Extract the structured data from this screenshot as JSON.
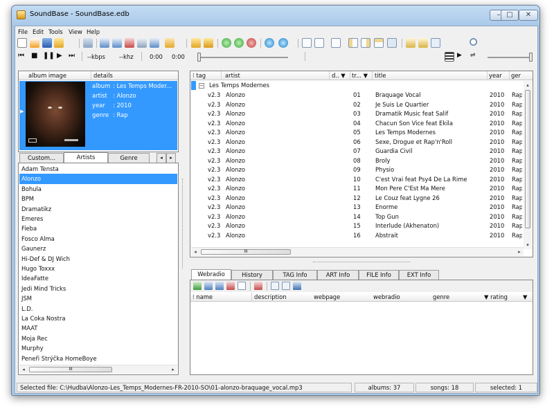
{
  "window": {
    "title": "SoundBase - SoundBase.edb"
  },
  "controls": {
    "minimize": "–",
    "maximize": "□",
    "close": "✕"
  },
  "menu": [
    "File",
    "Edit",
    "Tools",
    "View",
    "Help"
  ],
  "player": {
    "kbps": "--kbps",
    "khz": "--khz",
    "time_elapsed": "0:00",
    "time_total": "0:00"
  },
  "album_panel": {
    "headers": {
      "image": "album image",
      "details": "details"
    },
    "details": [
      {
        "label": "album",
        "value": ": Les Temps Moder..."
      },
      {
        "label": "artist",
        "value": ": Alonzo"
      },
      {
        "label": "year",
        "value": ": 2010"
      },
      {
        "label": "genre",
        "value": ": Rap"
      }
    ]
  },
  "left_tabs": [
    "Custom...",
    "Artists",
    "Genre"
  ],
  "left_tabs_active": 1,
  "artists": [
    "Adam Tensta",
    "Alonzo",
    "Bohula",
    "BPM",
    "Dramatikz",
    "Emeres",
    "Fieba",
    "Fosco Alma",
    "Gaunerz",
    "Hi-Def & DJ Wich",
    "Hugo Toxxx",
    "IdeaFatte",
    "Jedi Mind Tricks",
    "JSM",
    "L.D.",
    "La Coka Nostra",
    "MAAT",
    "Moja Rec",
    "Murphy",
    "Peneři Strýčka HomeBoye"
  ],
  "artists_selected": 1,
  "tracks": {
    "headers": {
      "tag": "tag",
      "artist": "artist",
      "d": "d.. ▼",
      "tr": "tr... ▼",
      "title": "title",
      "year": "year",
      "genre": "genr"
    },
    "group": "Les Temps Modernes",
    "rows": [
      {
        "tag": "v2.3",
        "artist": "Alonzo",
        "track": "01",
        "title": "Braquage Vocal",
        "year": "2010",
        "genre": "Rap"
      },
      {
        "tag": "v2.3",
        "artist": "Alonzo",
        "track": "02",
        "title": "Je Suis Le Quartier",
        "year": "2010",
        "genre": "Rap"
      },
      {
        "tag": "v2.3",
        "artist": "Alonzo",
        "track": "03",
        "title": "Dramatik Music feat Salif",
        "year": "2010",
        "genre": "Rap"
      },
      {
        "tag": "v2.3",
        "artist": "Alonzo",
        "track": "04",
        "title": "Chacun Son Vice feat Ekila",
        "year": "2010",
        "genre": "Rap"
      },
      {
        "tag": "v2.3",
        "artist": "Alonzo",
        "track": "05",
        "title": "Les Temps Modernes",
        "year": "2010",
        "genre": "Rap"
      },
      {
        "tag": "v2.3",
        "artist": "Alonzo",
        "track": "06",
        "title": "Sexe, Drogue et Rap'n'Roll",
        "year": "2010",
        "genre": "Rap"
      },
      {
        "tag": "v2.3",
        "artist": "Alonzo",
        "track": "07",
        "title": "Guardia Civil",
        "year": "2010",
        "genre": "Rap"
      },
      {
        "tag": "v2.3",
        "artist": "Alonzo",
        "track": "08",
        "title": "Broly",
        "year": "2010",
        "genre": "Rap"
      },
      {
        "tag": "v2.3",
        "artist": "Alonzo",
        "track": "09",
        "title": "Physio",
        "year": "2010",
        "genre": "Rap"
      },
      {
        "tag": "v2.3",
        "artist": "Alonzo",
        "track": "10",
        "title": "C'est Vrai feat Psy4 De La Rime",
        "year": "2010",
        "genre": "Rap"
      },
      {
        "tag": "v2.3",
        "artist": "Alonzo",
        "track": "11",
        "title": "Mon Pere C'Est Ma Mere",
        "year": "2010",
        "genre": "Rap"
      },
      {
        "tag": "v2.3",
        "artist": "Alonzo",
        "track": "12",
        "title": "Le Couz feat Lygne 26",
        "year": "2010",
        "genre": "Rap"
      },
      {
        "tag": "v2.3",
        "artist": "Alonzo",
        "track": "13",
        "title": "Enorme",
        "year": "2010",
        "genre": "Rap"
      },
      {
        "tag": "v2.3",
        "artist": "Alonzo",
        "track": "14",
        "title": "Top Gun",
        "year": "2010",
        "genre": "Rap"
      },
      {
        "tag": "v2.3",
        "artist": "Alonzo",
        "track": "15",
        "title": "Interlude (Akhenaton)",
        "year": "2010",
        "genre": "Rap"
      },
      {
        "tag": "v2.3",
        "artist": "Alonzo",
        "track": "16",
        "title": "Abstrait",
        "year": "2010",
        "genre": "Rap"
      }
    ]
  },
  "bottom_tabs": [
    "Webradio",
    "History",
    "TAG Info",
    "ART Info",
    "FILE Info",
    "EXT Info"
  ],
  "bottom_tabs_active": 0,
  "webradio": {
    "headers": {
      "name": "name",
      "description": "description",
      "webpage": "webpage",
      "webradio": "webradio",
      "genre": "genre",
      "rating": "▼ rating"
    }
  },
  "scroll": {
    "left": "◂",
    "right": "▸",
    "up": "▴",
    "down": "▾",
    "grip": "III"
  },
  "status": {
    "file": "Selected file: C:\\Hudba\\Alonzo-Les_Temps_Modernes-FR-2010-SO\\01-alonzo-braquage_vocal.mp3",
    "albums": "albums: 37",
    "songs": "songs: 18",
    "selected": "selected: 1"
  },
  "colors": {
    "selection": "#3399ff",
    "title_bar": "#a9c9ea",
    "frame": "#f0f0f0"
  }
}
